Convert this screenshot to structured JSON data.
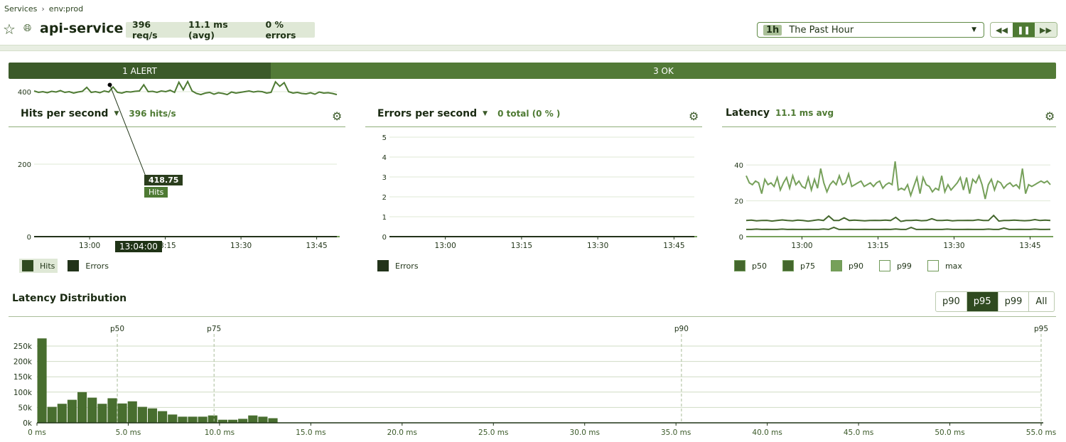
{
  "breadcrumb": [
    "Services",
    "env:prod"
  ],
  "header": {
    "title": "api-service",
    "stats": [
      "396 req/s",
      "11.1 ms (avg)",
      "0 % errors"
    ],
    "time_badge": "1h",
    "time_label": "The Past Hour"
  },
  "colors": {
    "dark": "#2f4a20",
    "primary": "#4e7a33",
    "alert": "#3b5a29",
    "ok": "#527a37",
    "light": "#76a05a"
  },
  "alerts": {
    "alert_label": "1 ALERT",
    "ok_label": "3 OK",
    "alert_count": 1,
    "ok_count": 3
  },
  "panels": {
    "hits": {
      "title": "Hits per second",
      "summary": "396 hits/s",
      "legend": [
        "Hits",
        "Errors"
      ],
      "tooltip": {
        "value": "418.75",
        "series": "Hits",
        "time": "13:04:00"
      }
    },
    "errors": {
      "title": "Errors per second",
      "summary": "0 total (0 % )",
      "legend": [
        "Errors"
      ]
    },
    "latency": {
      "title": "Latency",
      "summary": "11.1 ms avg",
      "legend": [
        "p50",
        "p75",
        "p90",
        "p99",
        "max"
      ]
    },
    "dist": {
      "title": "Latency Distribution",
      "buttons": [
        "p90",
        "p95",
        "p99",
        "All"
      ],
      "selected": "p95"
    }
  },
  "chart_data": [
    {
      "type": "line",
      "x_start": "12:49",
      "x_end": "13:49",
      "xticks": [
        "13:00",
        "13:15",
        "13:30",
        "13:45"
      ],
      "ylim": [
        0,
        500
      ],
      "yticks": [
        "0",
        "200",
        "400"
      ],
      "series": [
        {
          "name": "Hits",
          "values": [
            402,
            398,
            400,
            397,
            401,
            399,
            403,
            398,
            400,
            396,
            399,
            401,
            412,
            398,
            400,
            397,
            402,
            399,
            413,
            398,
            396,
            400,
            399,
            401,
            402,
            419,
            400,
            401,
            398,
            402,
            400,
            404,
            398,
            426,
            405,
            428,
            402,
            395,
            392,
            396,
            398,
            393,
            397,
            395,
            392,
            399,
            396,
            398,
            400,
            402,
            399,
            401,
            400,
            396,
            398,
            427,
            415,
            425,
            400,
            396,
            398,
            395,
            394,
            397,
            393,
            399,
            396,
            397,
            395,
            392
          ]
        },
        {
          "name": "Errors",
          "values": [
            0,
            0,
            0,
            0,
            0,
            0,
            0,
            0,
            0,
            0,
            0,
            0,
            0,
            0,
            0,
            0,
            0,
            0,
            0,
            0,
            0,
            0,
            0,
            0,
            0,
            0,
            0,
            0,
            0,
            0,
            0,
            0,
            0,
            0,
            0,
            0,
            0,
            0,
            0,
            0,
            0,
            0,
            0,
            0,
            0,
            0,
            0,
            0,
            0,
            0,
            0,
            0,
            0,
            0,
            0,
            0,
            0,
            0,
            0,
            0,
            0,
            0,
            0,
            0,
            0,
            0,
            0,
            0,
            0,
            0
          ]
        }
      ]
    },
    {
      "type": "line",
      "x_start": "12:49",
      "x_end": "13:49",
      "xticks": [
        "13:00",
        "13:15",
        "13:30",
        "13:45"
      ],
      "ylim": [
        0,
        5
      ],
      "yticks": [
        "0",
        "1",
        "2",
        "3",
        "4",
        "5"
      ],
      "series": [
        {
          "name": "Errors",
          "values": [
            0,
            0,
            0,
            0,
            0,
            0,
            0,
            0,
            0,
            0,
            0,
            0,
            0,
            0,
            0,
            0,
            0,
            0,
            0,
            0,
            0
          ]
        }
      ]
    },
    {
      "type": "line",
      "x_start": "12:49",
      "x_end": "13:49",
      "xticks": [
        "13:00",
        "13:15",
        "13:30",
        "13:45"
      ],
      "ylim": [
        0,
        46
      ],
      "yticks": [
        "0",
        "20",
        "40"
      ],
      "series": [
        {
          "name": "p50",
          "values": [
            4,
            4,
            4.2,
            4,
            4.1,
            4,
            4,
            4.2,
            4,
            4.1,
            4,
            4,
            4.1,
            4,
            4,
            4.3,
            4,
            5.2,
            4,
            4,
            4.1,
            4,
            4,
            4.1,
            4,
            4,
            4,
            4.1,
            4,
            4.3,
            4,
            4,
            5.1,
            4,
            4,
            4.1,
            4,
            4,
            4,
            4.2,
            4,
            4,
            4,
            4.1,
            4,
            4,
            4,
            4.2,
            4,
            4,
            4.8,
            4,
            4,
            4.1,
            4,
            4,
            4.2,
            4,
            4,
            4.1
          ]
        },
        {
          "name": "p75",
          "values": [
            9,
            9.2,
            8.8,
            9,
            9.1,
            8.7,
            9,
            9.3,
            9,
            8.8,
            9.2,
            9,
            8.6,
            9,
            9.4,
            9,
            11.5,
            9,
            9,
            10.5,
            9,
            9.2,
            9,
            8.8,
            9,
            9.1,
            9,
            9.2,
            9,
            10.8,
            8.5,
            9,
            9,
            9.2,
            8.9,
            9,
            10,
            9,
            9,
            9.2,
            8.8,
            9,
            9,
            9.1,
            9,
            9.4,
            9,
            9,
            11.8,
            8.7,
            9,
            9,
            9.2,
            9,
            8.9,
            9,
            9.5,
            9,
            9.2,
            9
          ]
        },
        {
          "name": "p90",
          "values": [
            34,
            30,
            29,
            31,
            30,
            24,
            32,
            29,
            30,
            28,
            33,
            26,
            30,
            33,
            27,
            34,
            29,
            31,
            28,
            27,
            33,
            26,
            32,
            27,
            38,
            30,
            25,
            29,
            31,
            29,
            34,
            29,
            30,
            35,
            28,
            29,
            30,
            31,
            28,
            29,
            30,
            28,
            30,
            31,
            27,
            29,
            30,
            29,
            42,
            26,
            27,
            26,
            29,
            23,
            28,
            33,
            24,
            33,
            29,
            28,
            25,
            27,
            26,
            34,
            25,
            29,
            26,
            28,
            30,
            33,
            26,
            33,
            24,
            32,
            30,
            34,
            29,
            21,
            29,
            32,
            26,
            31,
            30,
            27,
            29,
            30,
            28,
            29,
            27,
            38,
            24,
            29,
            28,
            29,
            30,
            31,
            30,
            31,
            29
          ]
        },
        {
          "name": "p99",
          "values": []
        },
        {
          "name": "max",
          "values": []
        }
      ]
    },
    {
      "type": "bar",
      "xlabel": "",
      "xlim": [
        0,
        55
      ],
      "xticks": [
        "0 ms",
        "5.0 ms",
        "10.0 ms",
        "15.0 ms",
        "20.0 ms",
        "25.0 ms",
        "30.0 ms",
        "35.0 ms",
        "40.0 ms",
        "45.0 ms",
        "50.0 ms",
        "55.0 ms"
      ],
      "yticks": [
        "0k",
        "50k",
        "100k",
        "150k",
        "200k",
        "250k"
      ],
      "ylim": [
        0,
        260000
      ],
      "bin_width_ms": 0.55,
      "values": [
        275000,
        52000,
        62000,
        75000,
        100000,
        82000,
        62000,
        80000,
        63000,
        70000,
        52000,
        47000,
        38000,
        27000,
        20000,
        20000,
        20000,
        24000,
        10000,
        10000,
        13000,
        24000,
        20000,
        15000
      ],
      "percentiles": [
        {
          "name": "p50",
          "ms": 4.4
        },
        {
          "name": "p75",
          "ms": 9.7
        },
        {
          "name": "p90",
          "ms": 35.3
        },
        {
          "name": "p95",
          "ms": 55
        }
      ]
    }
  ]
}
